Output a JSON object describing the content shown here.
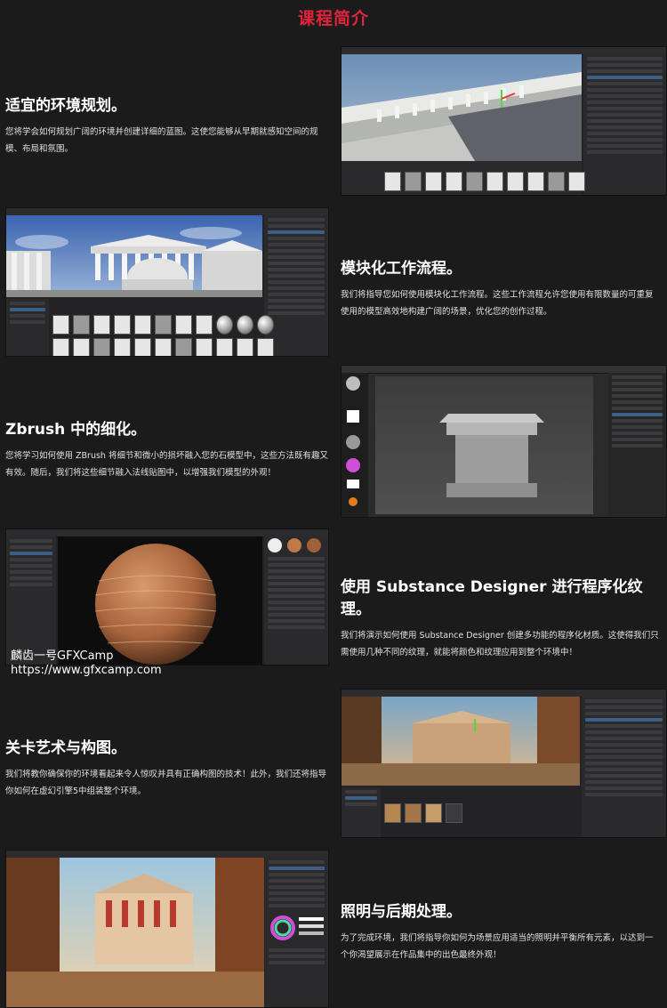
{
  "page": {
    "title": "课程简介"
  },
  "sections": [
    {
      "heading": "适宜的环境规划。",
      "body": "您将学会如何规划广阔的环境并创建详细的蓝图。这使您能够从早期就感知空间的规模、布局和氛围。"
    },
    {
      "heading": "模块化工作流程。",
      "body": "我们将指导您如何使用模块化工作流程。这些工作流程允许您使用有限数量的可重复使用的模型高效地构建广阔的场景，优化您的创作过程。"
    },
    {
      "heading": "Zbrush 中的细化。",
      "body": "您将学习如何使用 ZBrush 将细节和微小的损坏融入您的石模型中，这些方法既有趣又有效。随后，我们将这些细节融入法线贴图中，以增强我们模型的外观！"
    },
    {
      "heading": "使用 Substance Designer 进行程序化纹理。",
      "body": "我们将演示如何使用 Substance Designer 创建多功能的程序化材质。这使得我们只需使用几种不同的纹理，就能将颜色和纹理应用到整个环境中！"
    },
    {
      "heading": "关卡艺术与构图。",
      "body": "我们将教你确保你的环境看起来令人惊叹并具有正确构图的技术！此外，我们还将指导你如何在虚幻引擎5中组装整个环境。"
    },
    {
      "heading": "照明与后期处理。",
      "body": "为了完成环境，我们将指导你如何为场景应用适当的照明并平衡所有元素，以达到一个你渴望展示在作品集中的出色最终外观！"
    }
  ],
  "screenshots": [
    {
      "icon": "unreal-editor-planning-screenshot"
    },
    {
      "icon": "unreal-editor-modular-screenshot"
    },
    {
      "icon": "zbrush-screenshot"
    },
    {
      "icon": "substance-designer-screenshot"
    },
    {
      "icon": "unreal-editor-level-art-screenshot"
    },
    {
      "icon": "unreal-editor-lighting-screenshot"
    }
  ],
  "watermark": {
    "line1": "麟齿一号GFXCamp",
    "line2": "https://www.gfxcamp.com"
  }
}
